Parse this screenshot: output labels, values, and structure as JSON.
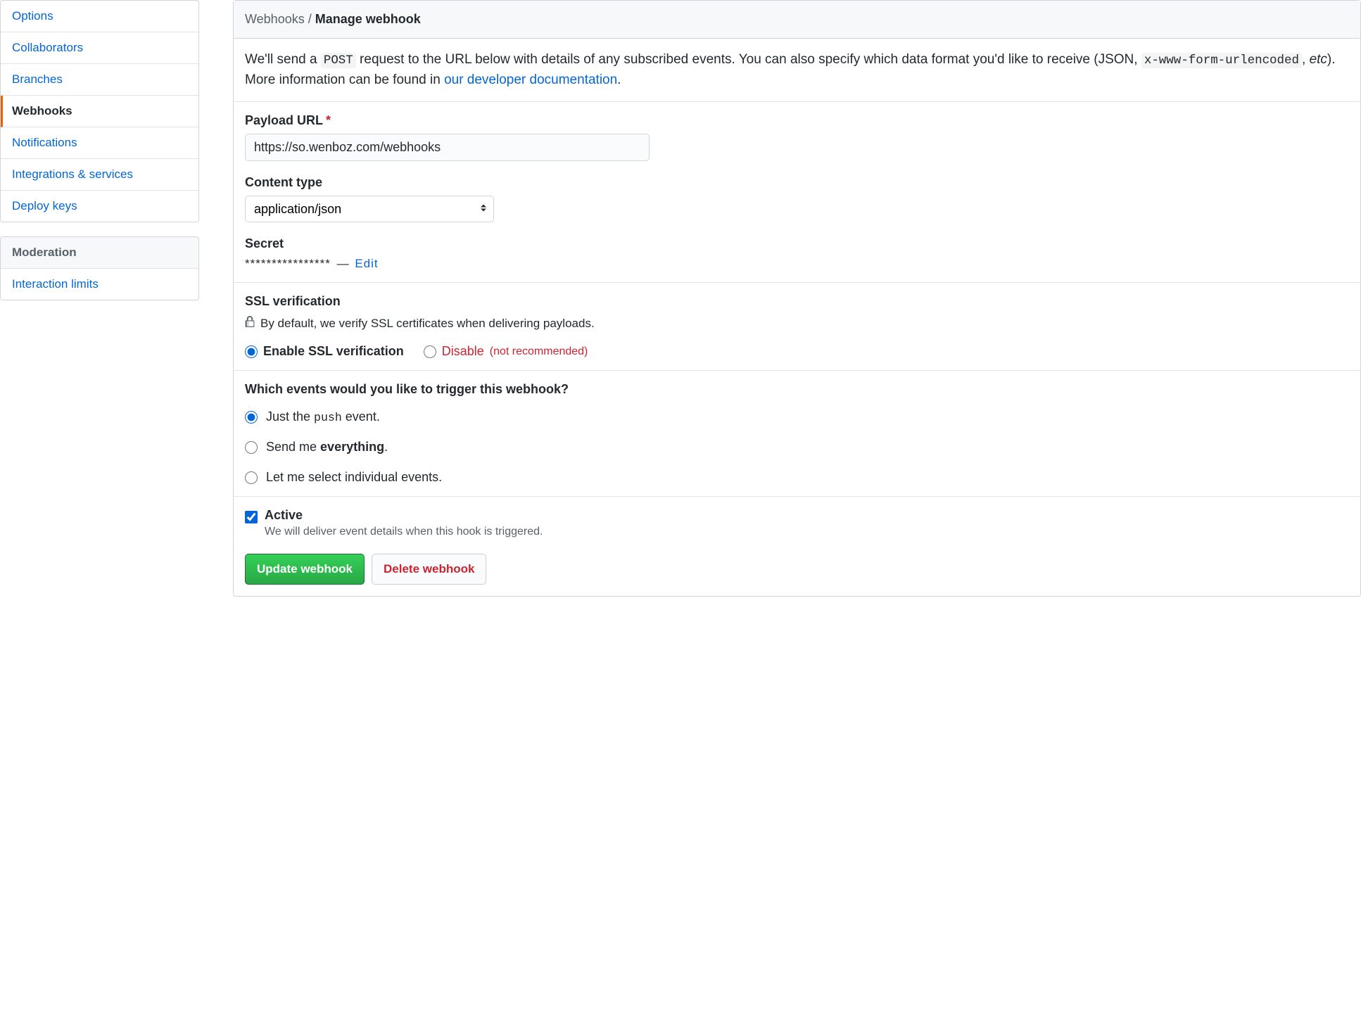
{
  "sidebar": {
    "items": [
      {
        "label": "Options"
      },
      {
        "label": "Collaborators"
      },
      {
        "label": "Branches"
      },
      {
        "label": "Webhooks"
      },
      {
        "label": "Notifications"
      },
      {
        "label": "Integrations & services"
      },
      {
        "label": "Deploy keys"
      }
    ],
    "moderation_heading": "Moderation",
    "moderation_items": [
      {
        "label": "Interaction limits"
      }
    ]
  },
  "header": {
    "crumb": "Webhooks / ",
    "current": "Manage webhook"
  },
  "intro": {
    "part1": "We'll send a ",
    "code1": "POST",
    "part2": " request to the URL below with details of any subscribed events. You can also specify which data format you'd like to receive (JSON, ",
    "code2": "x-www-form-urlencoded",
    "part3": ", ",
    "etc": "etc",
    "part4": "). More information can be found in ",
    "link": "our developer documentation",
    "part5": "."
  },
  "form": {
    "payload_url_label": "Payload URL",
    "payload_url_value": "https://so.wenboz.com/webhooks",
    "content_type_label": "Content type",
    "content_type_value": "application/json",
    "secret_label": "Secret",
    "secret_masked": "****************",
    "secret_dash": " — ",
    "secret_edit": "Edit"
  },
  "ssl": {
    "heading": "SSL verification",
    "note": "By default, we verify SSL certificates when delivering payloads.",
    "enable_label": "Enable SSL verification",
    "disable_label": "Disable",
    "disable_note": "(not recommended)"
  },
  "events": {
    "heading": "Which events would you like to trigger this webhook?",
    "push_pre": "Just the ",
    "push_code": "push",
    "push_post": " event.",
    "everything_pre": "Send me ",
    "everything_bold": "everything",
    "everything_post": ".",
    "individual": "Let me select individual events."
  },
  "active": {
    "label": "Active",
    "desc": "We will deliver event details when this hook is triggered."
  },
  "buttons": {
    "update": "Update webhook",
    "delete": "Delete webhook"
  }
}
